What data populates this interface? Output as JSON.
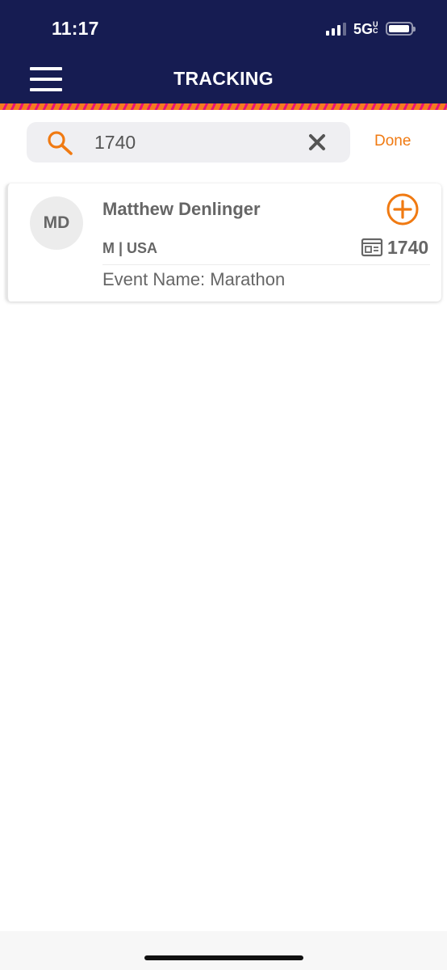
{
  "status_bar": {
    "time": "11:17",
    "network": "5G",
    "network_suffix": "UC",
    "signal_bars": 3,
    "battery_level": 0.95
  },
  "header": {
    "title": "TRACKING"
  },
  "search": {
    "value": "1740",
    "done_label": "Done"
  },
  "results": [
    {
      "initials": "MD",
      "name": "Matthew Denlinger",
      "info": "M | USA",
      "bib": "1740",
      "event": "Event Name: Marathon"
    }
  ],
  "colors": {
    "header_bg": "#161c52",
    "accent": "#f07a12",
    "stripe_pink": "#e6127a",
    "text_gray": "#666666"
  },
  "icons": {
    "menu": "hamburger-icon",
    "search": "magnifier-icon",
    "clear": "x-icon",
    "add": "plus-circle-icon",
    "bib": "bib-card-icon"
  }
}
